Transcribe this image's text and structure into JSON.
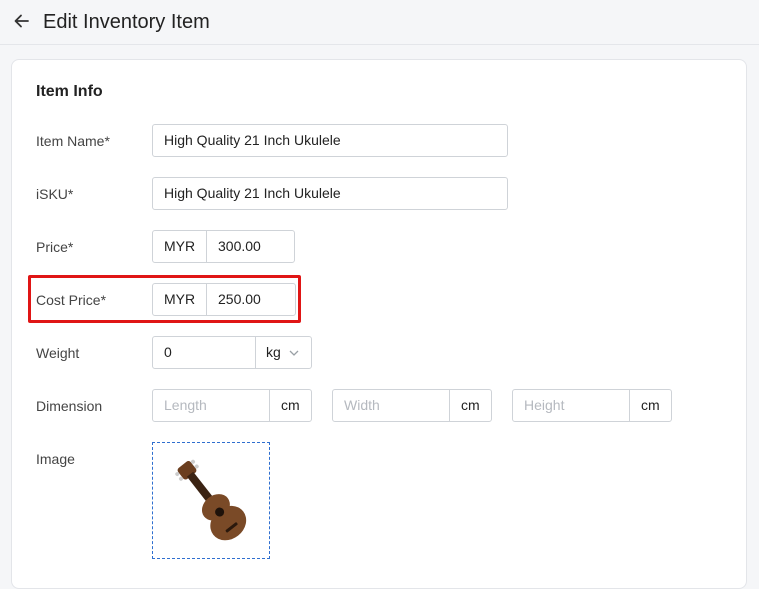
{
  "header": {
    "back_icon": "arrow-left-icon",
    "title": "Edit Inventory Item"
  },
  "item_info": {
    "section_title": "Item Info",
    "item_name": {
      "label": "Item Name*",
      "value": "High Quality 21 Inch Ukulele"
    },
    "isku": {
      "label": "iSKU*",
      "value": "High Quality 21 Inch Ukulele"
    },
    "price": {
      "label": "Price*",
      "currency": "MYR",
      "value": "300.00"
    },
    "cost_price": {
      "label": "Cost Price*",
      "currency": "MYR",
      "value": "250.00"
    },
    "weight": {
      "label": "Weight",
      "value": "0",
      "unit": "kg"
    },
    "dimension": {
      "label": "Dimension",
      "length_placeholder": "Length",
      "width_placeholder": "Width",
      "height_placeholder": "Height",
      "unit": "cm"
    },
    "image": {
      "label": "Image",
      "thumbnail": "ukulele-image"
    }
  },
  "colors": {
    "highlight": "#e01515",
    "image_border": "#2f6fcf"
  }
}
